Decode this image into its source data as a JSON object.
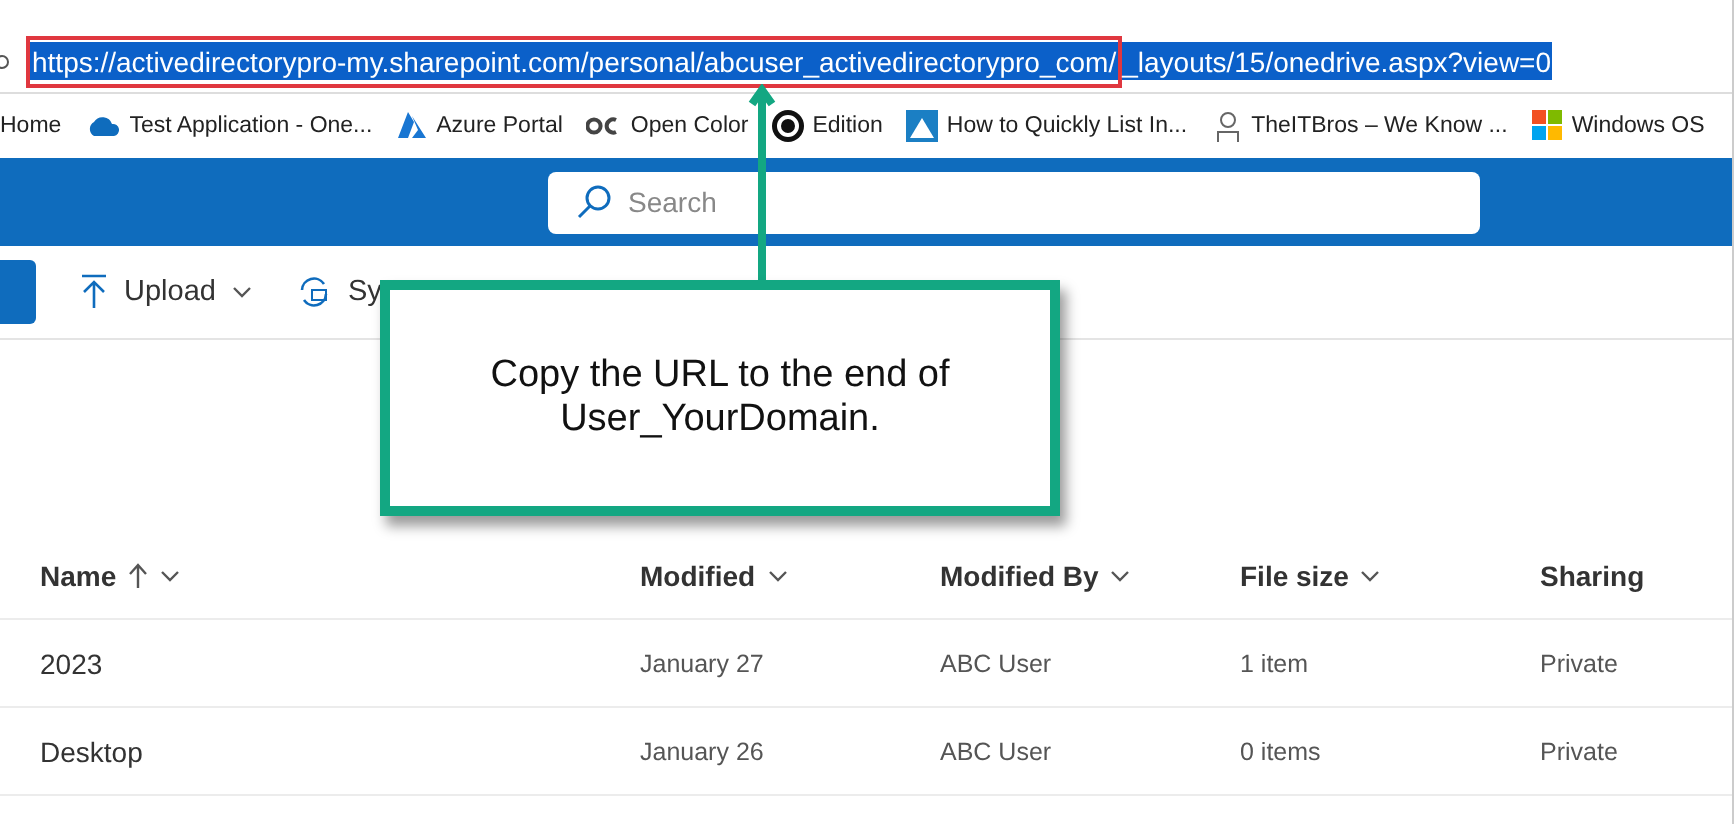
{
  "address_bar": {
    "url_marked": "https://activedirectorypro-my.sharepoint.com/personal/abcuser_activedirectorypro_com/",
    "url_rest": "_layouts/15/onedrive.aspx?view=0",
    "selected": true
  },
  "bookmarks": [
    {
      "label": "Home",
      "kind": "plain"
    },
    {
      "label": "Test Application - One...",
      "kind": "cloud"
    },
    {
      "label": "Azure Portal",
      "kind": "azure"
    },
    {
      "label": "Open Color",
      "kind": "oc"
    },
    {
      "label": "Edition",
      "kind": "ring"
    },
    {
      "label": "How to Quickly List In...",
      "kind": "page"
    },
    {
      "label": "TheITBros – We Know ...",
      "kind": "figure"
    },
    {
      "label": "Windows OS",
      "kind": "windows"
    }
  ],
  "search": {
    "placeholder": "Search"
  },
  "toolbar": [
    {
      "label": "Upload",
      "kind": "upload",
      "dropdown": true
    },
    {
      "label": "Sy",
      "kind": "sync",
      "dropdown": false
    }
  ],
  "callout": {
    "text": "Copy the URL to the end of User_YourDomain."
  },
  "table": {
    "columns": [
      {
        "label": "Name",
        "sorted": true,
        "dropdown": true
      },
      {
        "label": "Modified",
        "sorted": false,
        "dropdown": true
      },
      {
        "label": "Modified By",
        "sorted": false,
        "dropdown": true
      },
      {
        "label": "File size",
        "sorted": false,
        "dropdown": true
      },
      {
        "label": "Sharing",
        "sorted": false,
        "dropdown": false
      }
    ],
    "rows": [
      [
        "2023",
        "January 27",
        "ABC User",
        "1 item",
        "Private"
      ],
      [
        "Desktop",
        "January 26",
        "ABC User",
        "0 items",
        "Private"
      ]
    ]
  }
}
